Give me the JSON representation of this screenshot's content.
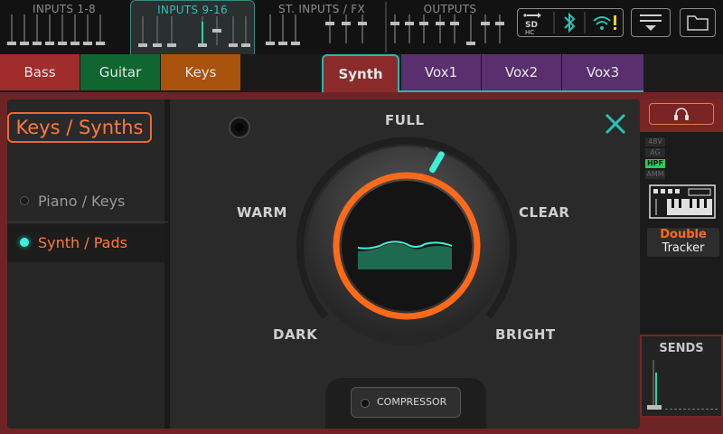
{
  "top_groups": [
    {
      "label": "INPUTS 1-8"
    },
    {
      "label": "INPUTS 9-16"
    },
    {
      "label": "ST. INPUTS / FX"
    },
    {
      "label": "OUTPUTS"
    }
  ],
  "status_icons": [
    "usb-icon",
    "sd-card-icon",
    "bluetooth-icon",
    "wifi-warning-icon"
  ],
  "tabs": [
    {
      "label": "Bass",
      "color": "#a12c2c"
    },
    {
      "label": "Guitar",
      "color": "#0f6630"
    },
    {
      "label": "Keys",
      "color": "#a8520c"
    },
    {
      "label": "Synth",
      "color": "#8b2b2b"
    },
    {
      "label": "Vox1",
      "color": "#5a2f6e"
    },
    {
      "label": "Vox2",
      "color": "#5a2f6e"
    },
    {
      "label": "Vox3",
      "color": "#5a2f6e"
    }
  ],
  "preset": {
    "title": "Keys / Synths",
    "options": [
      {
        "label": "Piano / Keys",
        "selected": false
      },
      {
        "label": "Synth / Pads",
        "selected": true
      }
    ]
  },
  "tone_dial": {
    "labels": {
      "top": "FULL",
      "left": "WARM",
      "right": "CLEAR",
      "bottom_left": "DARK",
      "bottom_right": "BRIGHT"
    }
  },
  "compressor": {
    "label": "COMPRESSOR"
  },
  "right_panel": {
    "badges": [
      "48V",
      "AG",
      "HPF",
      "AMM"
    ],
    "double_tracker_line1": "Double",
    "double_tracker_line2": "Tracker",
    "sends_label": "SENDS"
  },
  "colors": {
    "accent": "#27c4b4",
    "orange": "#ff6a1a",
    "frame": "#6e2424"
  }
}
